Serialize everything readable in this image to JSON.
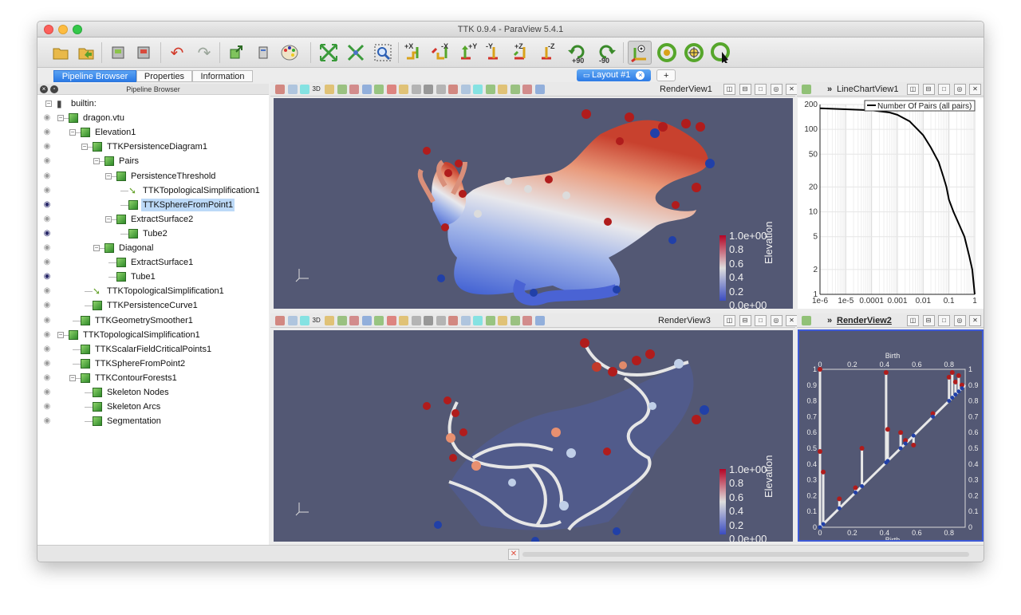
{
  "window": {
    "title": "TTK 0.9.4 - ParaView 5.4.1"
  },
  "toolbar": {
    "axis_buttons": [
      "+X",
      "-X",
      "+Y",
      "-Y",
      "+Z",
      "-Z"
    ],
    "rotate_labels": [
      "+90",
      "-90"
    ]
  },
  "left_tabs": [
    "Pipeline Browser",
    "Properties",
    "Information"
  ],
  "pipeline_header": "Pipeline Browser",
  "pipeline": [
    {
      "label": "builtin:",
      "eye": "none",
      "depth": 0,
      "icon": "server-icon"
    },
    {
      "label": "dragon.vtu",
      "eye": "off",
      "depth": 1,
      "icon": "cube-icon"
    },
    {
      "label": "Elevation1",
      "eye": "off",
      "depth": 2,
      "icon": "cube-icon"
    },
    {
      "label": "TTKPersistenceDiagram1",
      "eye": "off",
      "depth": 3,
      "icon": "cube-icon"
    },
    {
      "label": "Pairs",
      "eye": "off",
      "depth": 4,
      "icon": "cube-icon"
    },
    {
      "label": "PersistenceThreshold",
      "eye": "off",
      "depth": 5,
      "icon": "cube-icon"
    },
    {
      "label": "TTKTopologicalSimplification1",
      "eye": "off",
      "depth": 6,
      "icon": "arrow-icon"
    },
    {
      "label": "TTKSphereFromPoint1",
      "eye": "on",
      "depth": 6,
      "icon": "cube-icon",
      "selected": true
    },
    {
      "label": "ExtractSurface2",
      "eye": "off",
      "depth": 5,
      "icon": "cube-icon"
    },
    {
      "label": "Tube2",
      "eye": "on",
      "depth": 6,
      "icon": "cube-icon"
    },
    {
      "label": "Diagonal",
      "eye": "off",
      "depth": 4,
      "icon": "cube-icon"
    },
    {
      "label": "ExtractSurface1",
      "eye": "off",
      "depth": 5,
      "icon": "cube-icon"
    },
    {
      "label": "Tube1",
      "eye": "on",
      "depth": 5,
      "icon": "cube-icon"
    },
    {
      "label": "TTKTopologicalSimplification1",
      "eye": "off",
      "depth": 3,
      "icon": "arrow-icon"
    },
    {
      "label": "TTKPersistenceCurve1",
      "eye": "off",
      "depth": 3,
      "icon": "cube-icon"
    },
    {
      "label": "TTKGeometrySmoother1",
      "eye": "off",
      "depth": 2,
      "icon": "cube-icon"
    },
    {
      "label": "TTKTopologicalSimplification1",
      "eye": "off",
      "depth": 1,
      "icon": "cube-icon"
    },
    {
      "label": "TTKScalarFieldCriticalPoints1",
      "eye": "off",
      "depth": 2,
      "icon": "cube-icon"
    },
    {
      "label": "TTKSphereFromPoint2",
      "eye": "off",
      "depth": 2,
      "icon": "cube-icon"
    },
    {
      "label": "TTKContourForests1",
      "eye": "off",
      "depth": 2,
      "icon": "cube-icon"
    },
    {
      "label": "Skeleton Nodes",
      "eye": "off",
      "depth": 3,
      "icon": "cube-icon"
    },
    {
      "label": "Skeleton Arcs",
      "eye": "off",
      "depth": 3,
      "icon": "cube-icon"
    },
    {
      "label": "Segmentation",
      "eye": "off",
      "depth": 3,
      "icon": "cube-icon"
    }
  ],
  "layout": {
    "tab_label": "Layout #1",
    "add_label": "+"
  },
  "views": {
    "render1": {
      "title": "RenderView1"
    },
    "render3": {
      "title": "RenderView3"
    },
    "linechart": {
      "title": "LineChartView1"
    },
    "render2": {
      "title": "RenderView2"
    },
    "toolbar_3d_label": "3D"
  },
  "colorbar": {
    "title": "Elevation",
    "ticks": [
      "1.0e+00",
      "0.8",
      "0.6",
      "0.4",
      "0.2",
      "0.0e+00"
    ],
    "color_high": "#b40426",
    "color_mid": "#dddddd",
    "color_low": "#3b4cc0"
  },
  "chart_data": [
    {
      "type": "line",
      "legend": "Number Of Pairs (all pairs)",
      "x_scale": "log",
      "y_scale": "log",
      "x_tick_labels": [
        "1e-6",
        "1e-5",
        "0.0001",
        "0.001",
        "0.01",
        "0.1",
        "1"
      ],
      "y_tick_labels": [
        "200",
        "100",
        "50",
        "20",
        "10",
        "5",
        "2",
        "1"
      ],
      "xlim": [
        1e-06,
        1
      ],
      "ylim": [
        1,
        200
      ],
      "x": [
        1e-06,
        1e-05,
        0.0001,
        0.0005,
        0.001,
        0.003,
        0.006,
        0.01,
        0.02,
        0.04,
        0.06,
        0.08,
        0.1,
        0.15,
        0.25,
        0.4,
        0.6,
        0.8,
        1.0
      ],
      "y": [
        180,
        175,
        170,
        160,
        150,
        125,
        100,
        85,
        60,
        40,
        27,
        20,
        14,
        10,
        7,
        5,
        3,
        2,
        1
      ],
      "line_color": "#000000",
      "grid": true
    },
    {
      "type": "scatter",
      "xlabel": "Birth",
      "ylabel": "Death",
      "x_tick_labels": [
        "0",
        "0.2",
        "0.4",
        "0.6",
        "0.8"
      ],
      "y_tick_labels": [
        "1",
        "0.9",
        "0.8",
        "0.7",
        "0.6",
        "0.5",
        "0.4",
        "0.3",
        "0.2",
        "0.1",
        "0"
      ],
      "xlim": [
        0,
        0.9
      ],
      "ylim": [
        0,
        1
      ],
      "pairs": [
        {
          "x": 0.0,
          "y": 1.0
        },
        {
          "x": 0.0,
          "y": 0.48
        },
        {
          "x": 0.02,
          "y": 0.35
        },
        {
          "x": 0.12,
          "y": 0.18
        },
        {
          "x": 0.22,
          "y": 0.25
        },
        {
          "x": 0.26,
          "y": 0.5
        },
        {
          "x": 0.41,
          "y": 0.98
        },
        {
          "x": 0.42,
          "y": 0.62
        },
        {
          "x": 0.5,
          "y": 0.6
        },
        {
          "x": 0.53,
          "y": 0.55
        },
        {
          "x": 0.58,
          "y": 0.52
        },
        {
          "x": 0.7,
          "y": 0.72
        },
        {
          "x": 0.8,
          "y": 0.95
        },
        {
          "x": 0.82,
          "y": 0.98
        },
        {
          "x": 0.84,
          "y": 0.92
        },
        {
          "x": 0.86,
          "y": 0.96
        },
        {
          "x": 0.88,
          "y": 0.9
        }
      ]
    }
  ]
}
